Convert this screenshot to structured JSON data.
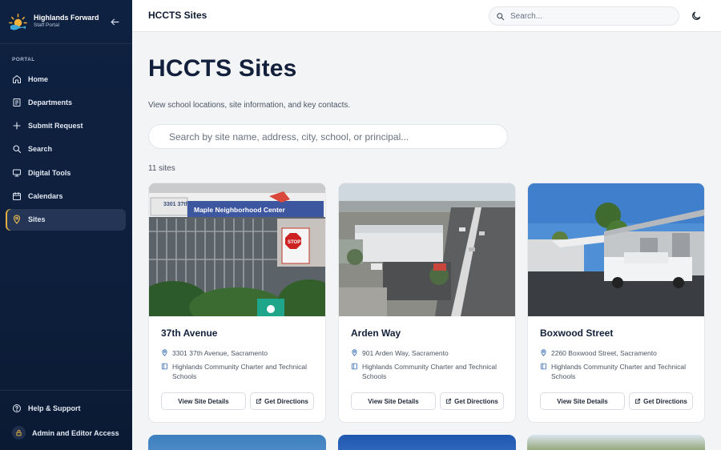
{
  "brand": {
    "title": "Highlands Forward",
    "subtitle": "Staff Portal"
  },
  "sidebar": {
    "section": "PORTAL",
    "items": [
      {
        "label": "Home",
        "icon": "home-icon"
      },
      {
        "label": "Departments",
        "icon": "building-icon"
      },
      {
        "label": "Submit Request",
        "icon": "plus-icon"
      },
      {
        "label": "Search",
        "icon": "search-icon"
      },
      {
        "label": "Digital Tools",
        "icon": "monitor-icon"
      },
      {
        "label": "Calendars",
        "icon": "calendar-icon"
      },
      {
        "label": "Sites",
        "icon": "map-pin-icon",
        "active": true
      }
    ],
    "help": "Help & Support",
    "admin": "Admin and Editor Access"
  },
  "topbar": {
    "title": "HCCTS Sites",
    "search_placeholder": "Search..."
  },
  "page": {
    "title": "HCCTS Sites",
    "subtitle": "View school locations, site information, and key contacts.",
    "search_placeholder": "Search by site name, address, city, school, or principal...",
    "count": "11 sites"
  },
  "sites": [
    {
      "name": "37th Avenue",
      "address": "3301 37th Avenue, Sacramento",
      "school": "Highlands Community Charter and Technical Schools",
      "details_label": "View Site Details",
      "directions_label": "Get Directions",
      "sign_text": "3301 37th Avenue",
      "sign_center": "Maple Neighborhood Center",
      "stop": "STOP"
    },
    {
      "name": "Arden Way",
      "address": "901 Arden Way, Sacramento",
      "school": "Highlands Community Charter and Technical Schools",
      "details_label": "View Site Details",
      "directions_label": "Get Directions"
    },
    {
      "name": "Boxwood Street",
      "address": "2260 Boxwood Street, Sacramento",
      "school": "Highlands Community Charter and Technical Schools",
      "details_label": "View Site Details",
      "directions_label": "Get Directions"
    }
  ],
  "colors": {
    "sidebar": "#0f2140",
    "accent": "#f2c14e",
    "link_icon": "#3b6fb6"
  }
}
